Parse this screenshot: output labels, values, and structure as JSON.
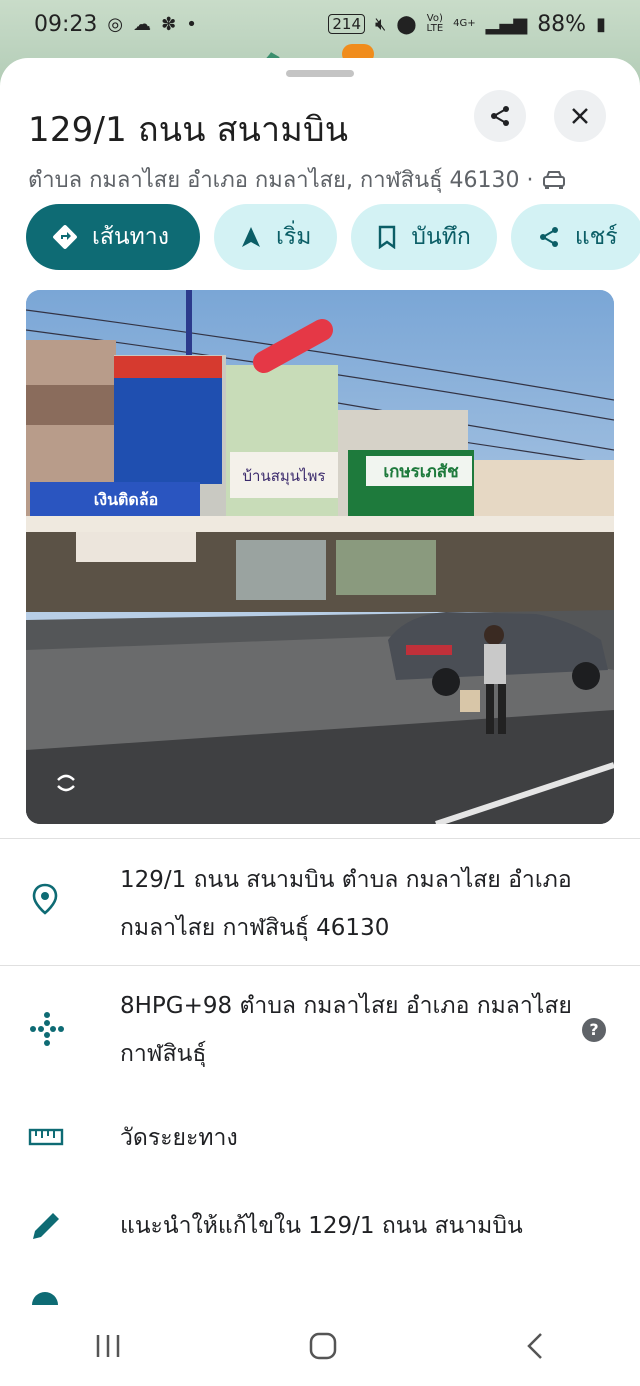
{
  "status_bar": {
    "time": "09:23",
    "notif_box": "2̈14",
    "network_a": "Vo)) LTE",
    "network_b": "4G+",
    "battery": "88%"
  },
  "place": {
    "title": "129/1 ถนน สนามบิน",
    "subtitle": "ตำบล กมลาไสย อำเภอ กมลาไสย, กาฬสินธุ์ 46130 ·"
  },
  "actions": [
    {
      "label": "เส้นทาง",
      "icon": "directions-icon"
    },
    {
      "label": "เริ่ม",
      "icon": "navigation-arrow-icon"
    },
    {
      "label": "บันทึก",
      "icon": "bookmark-icon"
    },
    {
      "label": "แชร์",
      "icon": "share-icon"
    }
  ],
  "photo": {
    "sign_shop": "บ้านสมุนไพร",
    "sign_pharmacy": "เกษรเภสัช",
    "sign_tire": "เงินติดล้อ"
  },
  "details": [
    {
      "icon": "location-pin-icon",
      "text": "129/1 ถนน สนามบิน ตำบล กมลาไสย อำเภอ กมลาไสย กาฬสินธุ์ 46130"
    },
    {
      "icon": "plus-code-icon",
      "text": "8HPG+98 ตำบล กมลาไสย อำเภอ กมลาไสย กาฬสินธุ์"
    },
    {
      "icon": "ruler-icon",
      "text": "วัดระยะทาง"
    },
    {
      "icon": "pencil-icon",
      "text": "แนะนำให้แก้ไขใน 129/1 ถนน สนามบิน"
    }
  ],
  "colors": {
    "primary": "#0e6b74",
    "chip_bg": "#d3f2f4",
    "pin_orange": "#f08c1c"
  }
}
